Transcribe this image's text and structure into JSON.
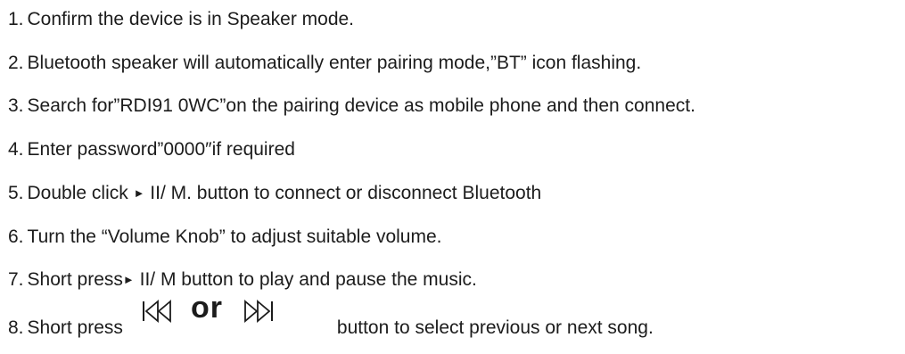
{
  "steps": [
    {
      "num": "1.",
      "text": "Confirm the device is in Speaker mode."
    },
    {
      "num": "2.",
      "text": "Bluetooth speaker will automatically enter pairing mode,”BT” icon flashing."
    },
    {
      "num": "3.",
      "text": "Search for”RDI91 0WC”on the pairing device as mobile phone and then connect."
    },
    {
      "num": "4.",
      "text": "Enter password”0000″if required"
    },
    {
      "num": "5.",
      "pre": "Double click ",
      "glyph": "►",
      "post": " II/ M. button to connect or disconnect Bluetooth"
    },
    {
      "num": "6.",
      "text": "Turn the “Volume Knob” to adjust suitable volume."
    },
    {
      "num": "7.",
      "pre": "Short press",
      "glyph": "►",
      "post": " II/ M button to play and pause the music."
    },
    {
      "num": "8.",
      "pre": "Short press",
      "post": "button to select previous or next song."
    }
  ],
  "icons": {
    "previous": "skip-previous-icon",
    "or_label": "or",
    "next": "skip-next-icon"
  }
}
